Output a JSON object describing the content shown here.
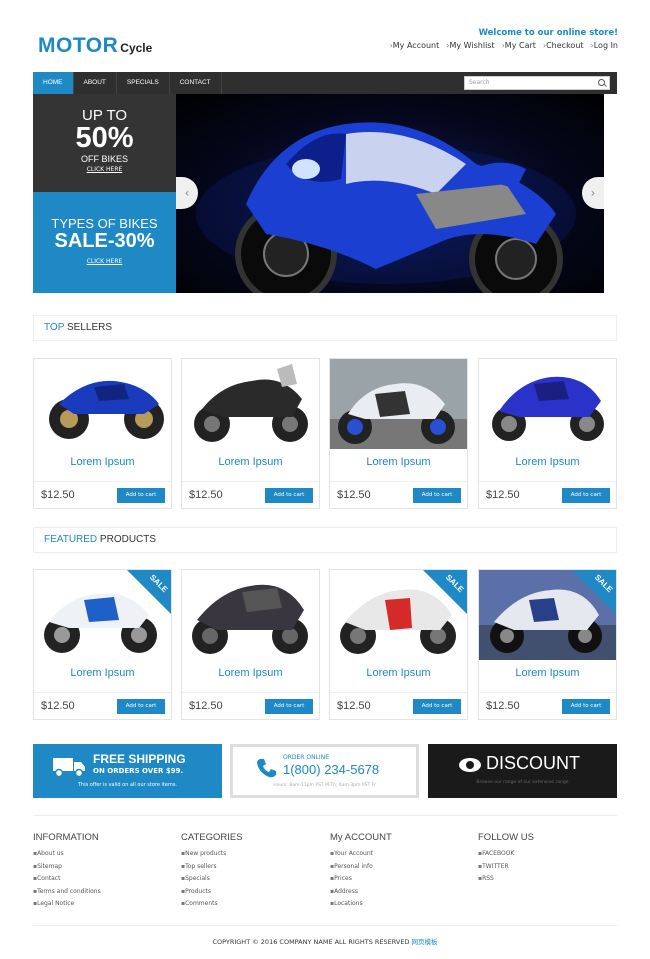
{
  "header": {
    "logo_big": "MOTOR",
    "logo_small": "Cycle",
    "welcome": "Welcome to our online store!",
    "links": [
      "My Account",
      "My Wishlist",
      "My Cart",
      "Checkout",
      "Log In"
    ]
  },
  "nav": {
    "items": [
      "HOME",
      "ABOUT",
      "SPECIALS",
      "CONTACT"
    ],
    "active": "HOME",
    "search_placeholder": "Search"
  },
  "promo1": {
    "line1": "UP TO",
    "line2": "50%",
    "line3": "OFF BIKES",
    "link": "CLICK HERE"
  },
  "promo2": {
    "line1": "TYPES OF BIKES",
    "line2": "SALE-30%",
    "link": "CLICK HERE"
  },
  "slider": {
    "prev": "‹",
    "next": "›"
  },
  "top_sellers": {
    "title_accent": "TOP",
    "title_rest": " SELLERS",
    "products": [
      {
        "name": "Lorem Ipsum",
        "price": "$12.50",
        "button": "Add to cart"
      },
      {
        "name": "Lorem Ipsum",
        "price": "$12.50",
        "button": "Add to cart"
      },
      {
        "name": "Lorem Ipsum",
        "price": "$12.50",
        "button": "Add to cart"
      },
      {
        "name": "Lorem Ipsum",
        "price": "$12.50",
        "button": "Add to cart"
      }
    ]
  },
  "featured": {
    "title_accent": "FEATURED",
    "title_rest": " PRODUCTS",
    "sale_label": "SALE",
    "products": [
      {
        "name": "Lorem Ipsum",
        "price": "$12.50",
        "button": "Add to cart"
      },
      {
        "name": "Lorem Ipsum",
        "price": "$12.50",
        "button": "Add to cart"
      },
      {
        "name": "Lorem Ipsum",
        "price": "$12.50",
        "button": "Add to cart"
      },
      {
        "name": "Lorem Ipsum",
        "price": "$12.50",
        "button": "Add to cart"
      }
    ]
  },
  "banners": {
    "shipping": {
      "title": "FREE SHIPPING",
      "subtitle": "ON ORDERS OVER $99.",
      "note": "This offer is valid on all our store items."
    },
    "order": {
      "label": "ORDER ONLINE",
      "phone": "1(800) 234-5678",
      "hours": "Hours: 8am-11pm PST M-Th; 6am-3pm PST Fr"
    },
    "discount": {
      "title": "DISCOUNT",
      "note": "Browse our range of our extensive range"
    }
  },
  "footer": {
    "columns": [
      {
        "title": "INFORMATION",
        "items": [
          "About us",
          "Sitemap",
          "Contact",
          "Terms and conditions",
          "Legal Notice"
        ]
      },
      {
        "title": "CATEGORIES",
        "items": [
          "New products",
          "Top sellers",
          "Specials",
          "Products",
          "Comments"
        ]
      },
      {
        "title": "My ACCOUNT",
        "items": [
          "Your Account",
          "Personal info",
          "Prices",
          "Address",
          "Locations"
        ]
      },
      {
        "title": "FOLLOW US",
        "items": [
          "FACEBOOK",
          "TWITTER",
          "RSS"
        ]
      }
    ],
    "copyright": "COPYRIGHT © 2016 COMPANY NAME ALL RIGHTS RESERVED",
    "copyright_cn": "网页模板"
  },
  "colors": {
    "accent": "#1e89c5",
    "dark": "#2f2f2f"
  }
}
